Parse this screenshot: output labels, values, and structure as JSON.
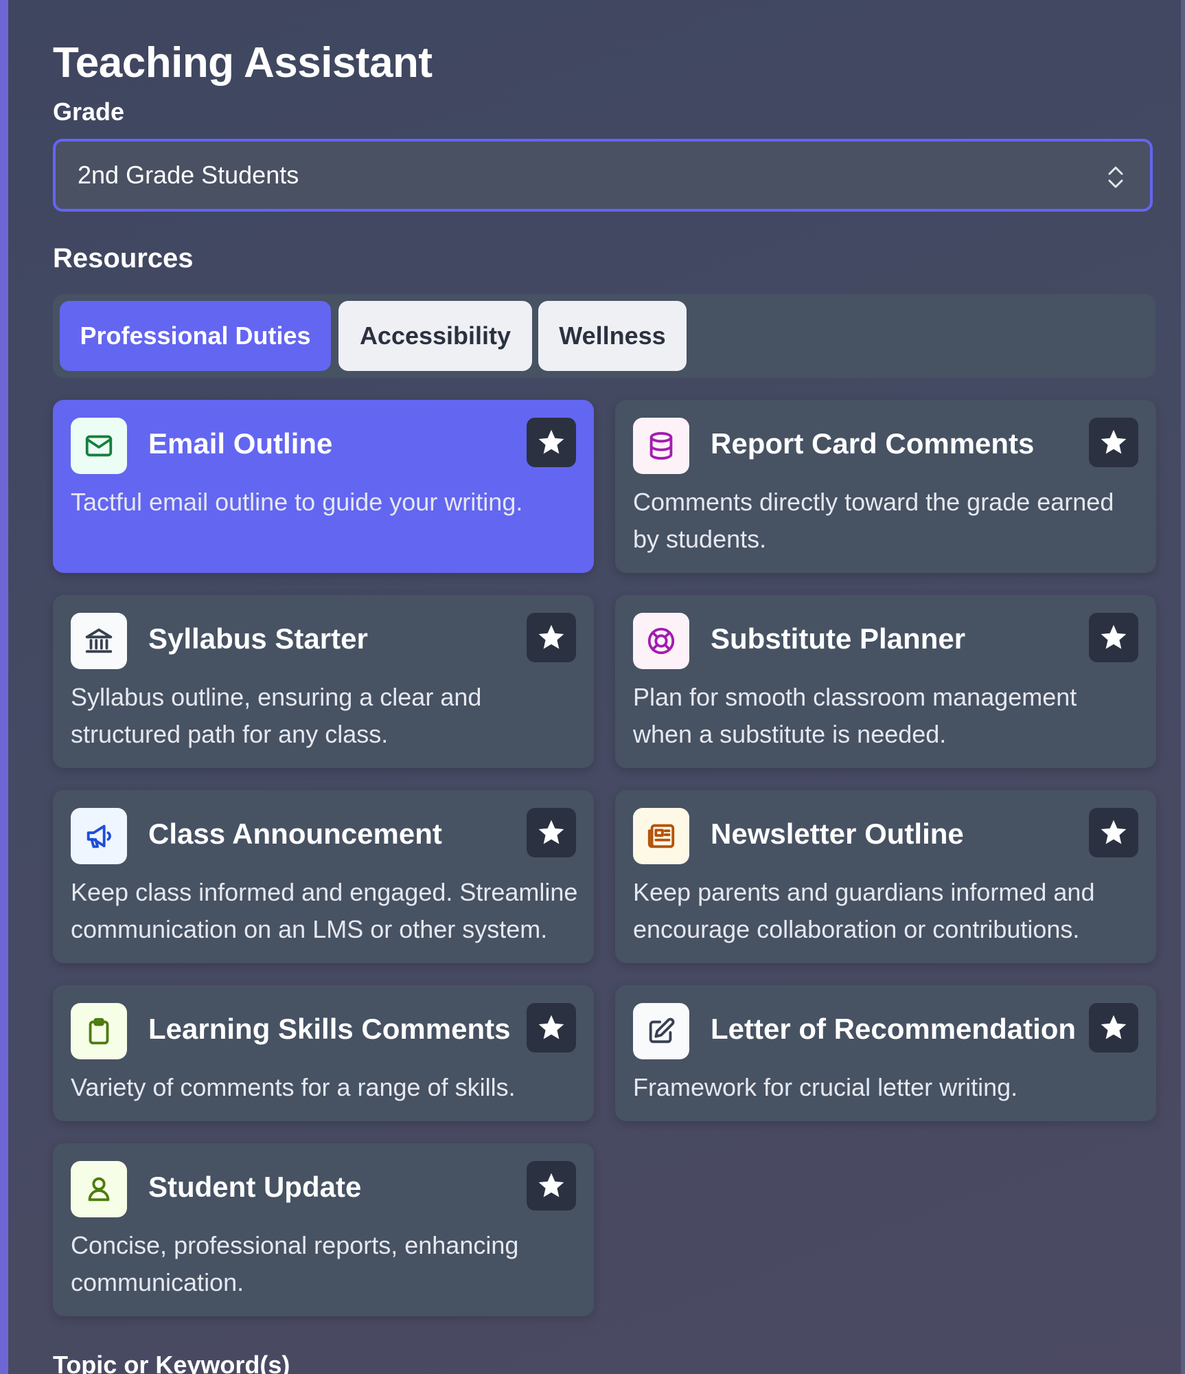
{
  "page_title": "Teaching Assistant",
  "grade": {
    "label": "Grade",
    "selected": "2nd Grade Students"
  },
  "resources": {
    "label": "Resources",
    "tabs": [
      {
        "label": "Professional Duties",
        "active": true
      },
      {
        "label": "Accessibility",
        "active": false
      },
      {
        "label": "Wellness",
        "active": false
      }
    ],
    "cards": [
      {
        "title": "Email Outline",
        "description": "Tactful email outline to guide your writing.",
        "icon": "mail-icon",
        "active": true
      },
      {
        "title": "Report Card Comments",
        "description": "Comments directly toward the grade earned by students.",
        "icon": "database-icon",
        "active": false
      },
      {
        "title": "Syllabus Starter",
        "description": "Syllabus outline, ensuring a clear and structured path for any class.",
        "icon": "building-columns-icon",
        "active": false
      },
      {
        "title": "Substitute Planner",
        "description": "Plan for smooth classroom management when a substitute is needed.",
        "icon": "lifebuoy-icon",
        "active": false
      },
      {
        "title": "Class Announcement",
        "description": "Keep class informed and engaged. Streamline communication on an LMS or other system.",
        "icon": "megaphone-icon",
        "active": false
      },
      {
        "title": "Newsletter Outline",
        "description": "Keep parents and guardians informed and encourage collaboration or contributions.",
        "icon": "newspaper-icon",
        "active": false
      },
      {
        "title": "Learning Skills Comments",
        "description": "Variety of comments for a range of skills.",
        "icon": "clipboard-icon",
        "active": false
      },
      {
        "title": "Letter of Recommendation",
        "description": "Framework for crucial letter writing.",
        "icon": "pencil-square-icon",
        "active": false
      },
      {
        "title": "Student Update",
        "description": "Concise, professional reports, enhancing communication.",
        "icon": "user-icon",
        "active": false
      }
    ]
  },
  "topic": {
    "label": "Topic or Keyword(s)"
  },
  "colors": {
    "accent": "#6366f1",
    "card_bg": "#475263",
    "star_bg": "#2b3140",
    "icon_green": "#15803d",
    "icon_pink": "#a21caf",
    "icon_blue": "#1d4ed8",
    "icon_amber": "#b45309",
    "icon_lime": "#4d7c0f"
  }
}
